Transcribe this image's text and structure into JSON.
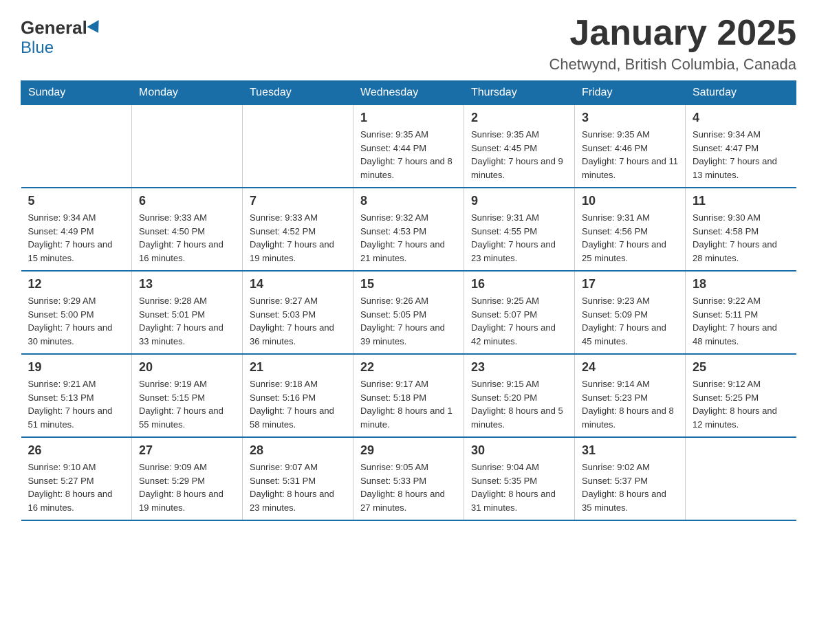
{
  "header": {
    "logo": {
      "general": "General",
      "blue": "Blue"
    },
    "title": "January 2025",
    "subtitle": "Chetwynd, British Columbia, Canada"
  },
  "days_of_week": [
    "Sunday",
    "Monday",
    "Tuesday",
    "Wednesday",
    "Thursday",
    "Friday",
    "Saturday"
  ],
  "weeks": [
    [
      {
        "day": "",
        "info": ""
      },
      {
        "day": "",
        "info": ""
      },
      {
        "day": "",
        "info": ""
      },
      {
        "day": "1",
        "info": "Sunrise: 9:35 AM\nSunset: 4:44 PM\nDaylight: 7 hours and 8 minutes."
      },
      {
        "day": "2",
        "info": "Sunrise: 9:35 AM\nSunset: 4:45 PM\nDaylight: 7 hours and 9 minutes."
      },
      {
        "day": "3",
        "info": "Sunrise: 9:35 AM\nSunset: 4:46 PM\nDaylight: 7 hours and 11 minutes."
      },
      {
        "day": "4",
        "info": "Sunrise: 9:34 AM\nSunset: 4:47 PM\nDaylight: 7 hours and 13 minutes."
      }
    ],
    [
      {
        "day": "5",
        "info": "Sunrise: 9:34 AM\nSunset: 4:49 PM\nDaylight: 7 hours and 15 minutes."
      },
      {
        "day": "6",
        "info": "Sunrise: 9:33 AM\nSunset: 4:50 PM\nDaylight: 7 hours and 16 minutes."
      },
      {
        "day": "7",
        "info": "Sunrise: 9:33 AM\nSunset: 4:52 PM\nDaylight: 7 hours and 19 minutes."
      },
      {
        "day": "8",
        "info": "Sunrise: 9:32 AM\nSunset: 4:53 PM\nDaylight: 7 hours and 21 minutes."
      },
      {
        "day": "9",
        "info": "Sunrise: 9:31 AM\nSunset: 4:55 PM\nDaylight: 7 hours and 23 minutes."
      },
      {
        "day": "10",
        "info": "Sunrise: 9:31 AM\nSunset: 4:56 PM\nDaylight: 7 hours and 25 minutes."
      },
      {
        "day": "11",
        "info": "Sunrise: 9:30 AM\nSunset: 4:58 PM\nDaylight: 7 hours and 28 minutes."
      }
    ],
    [
      {
        "day": "12",
        "info": "Sunrise: 9:29 AM\nSunset: 5:00 PM\nDaylight: 7 hours and 30 minutes."
      },
      {
        "day": "13",
        "info": "Sunrise: 9:28 AM\nSunset: 5:01 PM\nDaylight: 7 hours and 33 minutes."
      },
      {
        "day": "14",
        "info": "Sunrise: 9:27 AM\nSunset: 5:03 PM\nDaylight: 7 hours and 36 minutes."
      },
      {
        "day": "15",
        "info": "Sunrise: 9:26 AM\nSunset: 5:05 PM\nDaylight: 7 hours and 39 minutes."
      },
      {
        "day": "16",
        "info": "Sunrise: 9:25 AM\nSunset: 5:07 PM\nDaylight: 7 hours and 42 minutes."
      },
      {
        "day": "17",
        "info": "Sunrise: 9:23 AM\nSunset: 5:09 PM\nDaylight: 7 hours and 45 minutes."
      },
      {
        "day": "18",
        "info": "Sunrise: 9:22 AM\nSunset: 5:11 PM\nDaylight: 7 hours and 48 minutes."
      }
    ],
    [
      {
        "day": "19",
        "info": "Sunrise: 9:21 AM\nSunset: 5:13 PM\nDaylight: 7 hours and 51 minutes."
      },
      {
        "day": "20",
        "info": "Sunrise: 9:19 AM\nSunset: 5:15 PM\nDaylight: 7 hours and 55 minutes."
      },
      {
        "day": "21",
        "info": "Sunrise: 9:18 AM\nSunset: 5:16 PM\nDaylight: 7 hours and 58 minutes."
      },
      {
        "day": "22",
        "info": "Sunrise: 9:17 AM\nSunset: 5:18 PM\nDaylight: 8 hours and 1 minute."
      },
      {
        "day": "23",
        "info": "Sunrise: 9:15 AM\nSunset: 5:20 PM\nDaylight: 8 hours and 5 minutes."
      },
      {
        "day": "24",
        "info": "Sunrise: 9:14 AM\nSunset: 5:23 PM\nDaylight: 8 hours and 8 minutes."
      },
      {
        "day": "25",
        "info": "Sunrise: 9:12 AM\nSunset: 5:25 PM\nDaylight: 8 hours and 12 minutes."
      }
    ],
    [
      {
        "day": "26",
        "info": "Sunrise: 9:10 AM\nSunset: 5:27 PM\nDaylight: 8 hours and 16 minutes."
      },
      {
        "day": "27",
        "info": "Sunrise: 9:09 AM\nSunset: 5:29 PM\nDaylight: 8 hours and 19 minutes."
      },
      {
        "day": "28",
        "info": "Sunrise: 9:07 AM\nSunset: 5:31 PM\nDaylight: 8 hours and 23 minutes."
      },
      {
        "day": "29",
        "info": "Sunrise: 9:05 AM\nSunset: 5:33 PM\nDaylight: 8 hours and 27 minutes."
      },
      {
        "day": "30",
        "info": "Sunrise: 9:04 AM\nSunset: 5:35 PM\nDaylight: 8 hours and 31 minutes."
      },
      {
        "day": "31",
        "info": "Sunrise: 9:02 AM\nSunset: 5:37 PM\nDaylight: 8 hours and 35 minutes."
      },
      {
        "day": "",
        "info": ""
      }
    ]
  ]
}
